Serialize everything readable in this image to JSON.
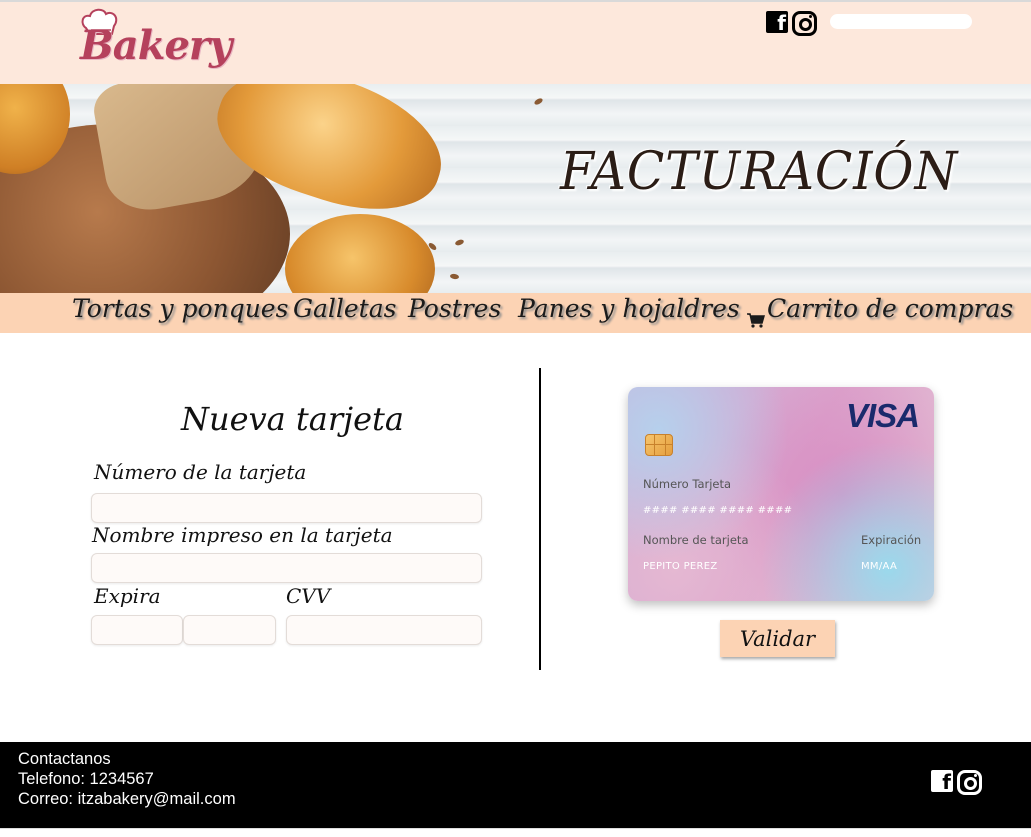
{
  "header": {
    "logo_text": "Bakery",
    "search": {
      "placeholder": "",
      "value": ""
    }
  },
  "banner": {
    "title": "FACTURACIÓN"
  },
  "nav": {
    "items": [
      {
        "label": "Tortas y ponques"
      },
      {
        "label": "Galletas"
      },
      {
        "label": "Postres"
      },
      {
        "label": "Panes y hojaldres"
      },
      {
        "label": "Carrito de compras",
        "icon": "cart-icon"
      }
    ]
  },
  "form": {
    "title": "Nueva tarjeta",
    "card_number_label": "Número de la tarjeta",
    "card_name_label": "Nombre impreso en la tarjeta",
    "expiry_label": "Expira",
    "cvv_label": "CVV"
  },
  "card": {
    "brand": "VISA",
    "number_label": "Número Tarjeta",
    "number_value": "#### #### #### ####",
    "name_label": "Nombre de tarjeta",
    "name_value": "PEPITO PEREZ",
    "expiry_label": "Expiración",
    "expiry_value": "MM/AA"
  },
  "validate_label": "Validar",
  "footer": {
    "contact_title": "Contactanos",
    "phone": "Telefono: 1234567",
    "email": "Correo: itzabakery@mail.com"
  },
  "colors": {
    "header_bg": "#fde8dc",
    "nav_bg": "#fcd3b4",
    "logo": "#b5415c",
    "card_brand": "#1a2a6c",
    "footer_bg": "#000000"
  },
  "icons": [
    "chef-hat-icon",
    "facebook-icon",
    "instagram-icon",
    "cart-icon",
    "card-chip-icon"
  ]
}
